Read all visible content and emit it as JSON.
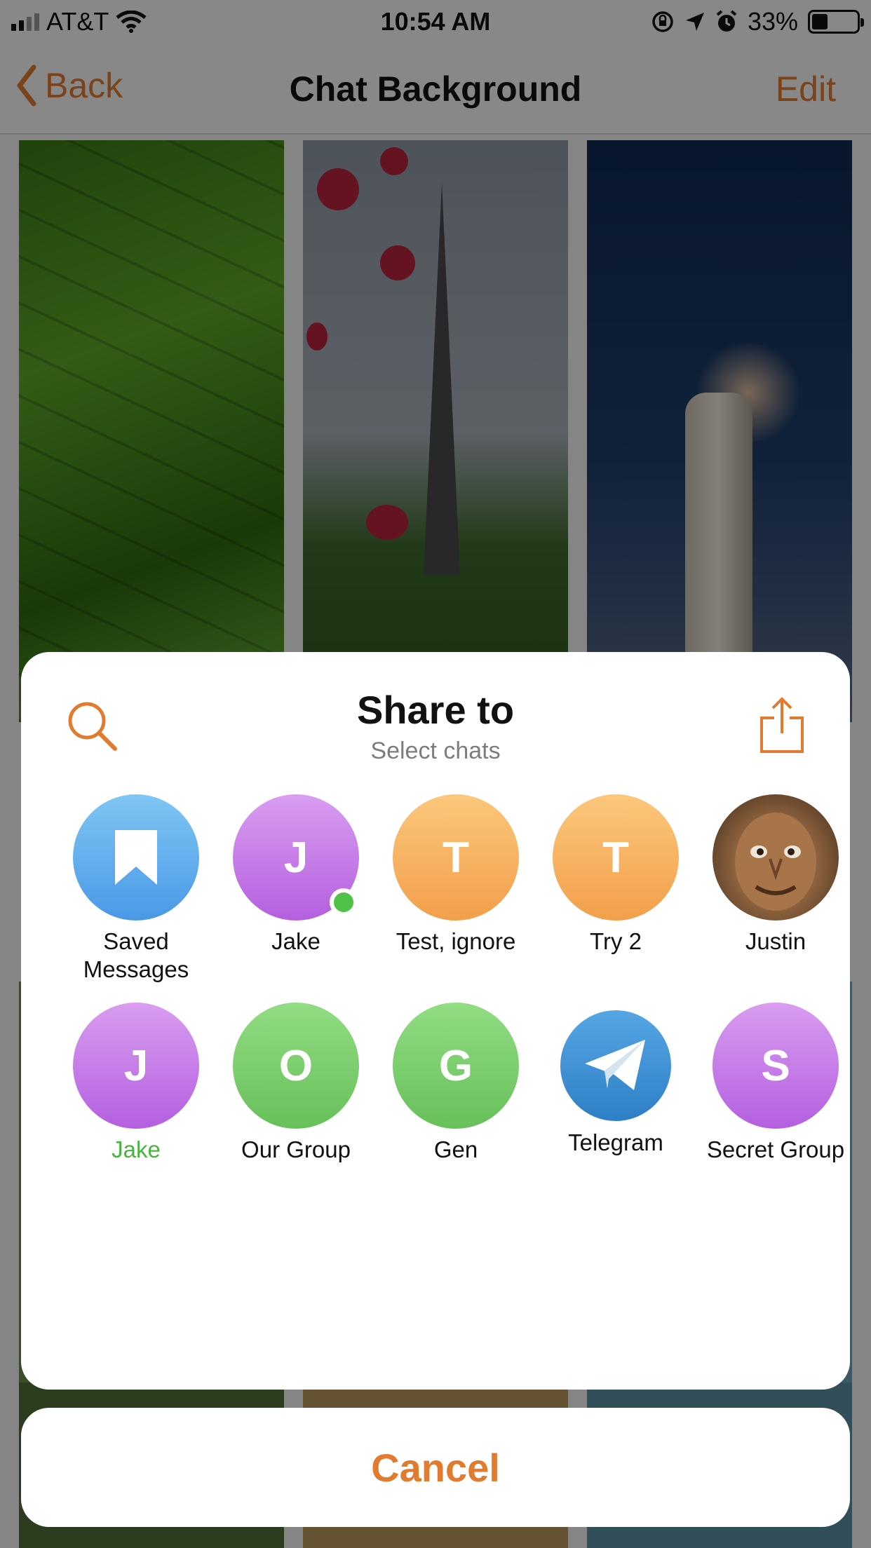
{
  "status_bar": {
    "carrier": "AT&T",
    "time": "10:54 AM",
    "battery_percent": "33%"
  },
  "nav": {
    "back_label": "Back",
    "title": "Chat Background",
    "edit_label": "Edit"
  },
  "share_sheet": {
    "title": "Share to",
    "subtitle": "Select chats",
    "contacts": [
      {
        "name": "Saved Messages",
        "initial": "",
        "color": "#5aa9ec",
        "icon": "bookmark-icon"
      },
      {
        "name": "Jake",
        "initial": "J",
        "color": "#c57be6",
        "online": true
      },
      {
        "name": "Test, ignore",
        "initial": "T",
        "color": "#f6b262"
      },
      {
        "name": "Try 2",
        "initial": "T",
        "color": "#f6b262"
      },
      {
        "name": "Justin",
        "initial": "",
        "color": "#8f6440",
        "icon": "profile-photo"
      },
      {
        "name": "Jake",
        "initial": "J",
        "color": "#c57be6",
        "highlight_color": "#4ab442"
      },
      {
        "name": "Our Group",
        "initial": "O",
        "color": "#79ce6c"
      },
      {
        "name": "Gen",
        "initial": "G",
        "color": "#79ce6c"
      },
      {
        "name": "Telegram",
        "initial": "",
        "color": "#3f90d5",
        "icon": "telegram-plane-icon"
      },
      {
        "name": "Secret Group",
        "initial": "S",
        "color": "#c57be6"
      }
    ]
  },
  "cancel_label": "Cancel",
  "colors": {
    "accent": "#e07b2f",
    "online": "#52c147"
  }
}
